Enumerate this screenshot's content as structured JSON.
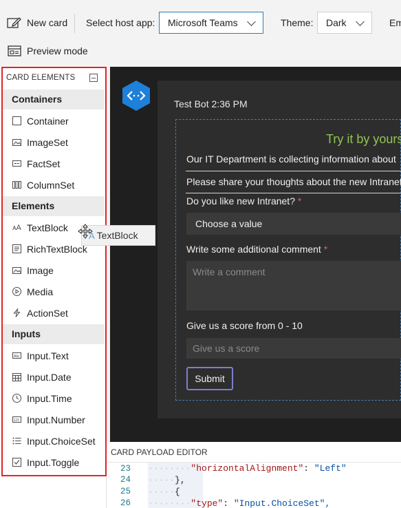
{
  "toolbar": {
    "new_card": "New card",
    "select_host_label": "Select host app:",
    "host_value": "Microsoft Teams",
    "theme_label": "Theme:",
    "theme_value": "Dark",
    "emulate_partial": "Em",
    "preview_mode": "Preview mode"
  },
  "palette": {
    "header": "CARD ELEMENTS",
    "categories": [
      "Containers",
      "Elements",
      "Inputs"
    ],
    "containers": [
      {
        "label": "Container",
        "icon": "container-icon"
      },
      {
        "label": "ImageSet",
        "icon": "imageset-icon"
      },
      {
        "label": "FactSet",
        "icon": "factset-icon"
      },
      {
        "label": "ColumnSet",
        "icon": "columnset-icon"
      }
    ],
    "elements": [
      {
        "label": "TextBlock",
        "icon": "textblock-icon"
      },
      {
        "label": "RichTextBlock",
        "icon": "richtextblock-icon"
      },
      {
        "label": "Image",
        "icon": "image-icon"
      },
      {
        "label": "Media",
        "icon": "media-icon"
      },
      {
        "label": "ActionSet",
        "icon": "actionset-icon"
      }
    ],
    "inputs": [
      {
        "label": "Input.Text",
        "icon": "input-text-icon"
      },
      {
        "label": "Input.Date",
        "icon": "input-date-icon"
      },
      {
        "label": "Input.Time",
        "icon": "input-time-icon"
      },
      {
        "label": "Input.Number",
        "icon": "input-number-icon"
      },
      {
        "label": "Input.ChoiceSet",
        "icon": "input-choiceset-icon"
      },
      {
        "label": "Input.Toggle",
        "icon": "input-toggle-icon"
      }
    ]
  },
  "drag": {
    "label": "TextBlock"
  },
  "preview": {
    "bot_meta": "Test Bot 2:36 PM",
    "card_title": "Try it by yourse",
    "intro_text": "Our IT Department is collecting information about",
    "prompt_text": "Please share your thoughts about the new Intranet",
    "q1_label": "Do you like new Intranet?",
    "q1_required": "*",
    "q1_value": "Choose a value",
    "q2_label": "Write some additional comment",
    "q2_required": "*",
    "q2_placeholder": "Write a comment",
    "q3_label": "Give us a score from 0 - 10",
    "q3_placeholder": "Give us a score",
    "submit": "Submit"
  },
  "editor": {
    "header": "CARD PAYLOAD EDITOR",
    "line_numbers": [
      "23",
      "24",
      "25",
      "26"
    ],
    "line23_key": "\"horizontalAlignment\"",
    "line23_val": "\"Left\"",
    "line24": "},",
    "line25": "{",
    "line26_key": "\"type\"",
    "line26_val": "\"Input.ChoiceSet\","
  },
  "colors": {
    "frame_highlight": "#e02424",
    "accent_green": "#92c353",
    "required_red": "#e0605e",
    "submit_border": "#7d7fcf",
    "bot_blue": "#1e80d8"
  }
}
